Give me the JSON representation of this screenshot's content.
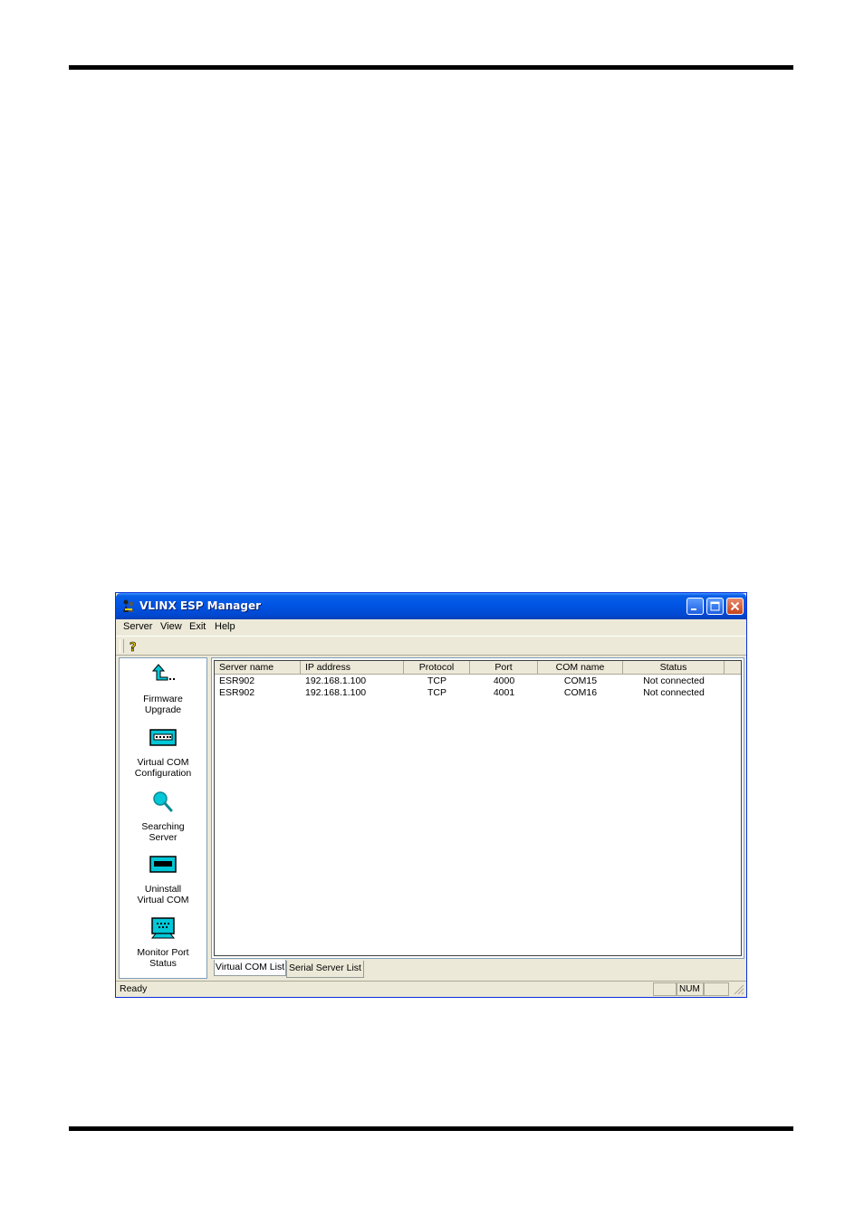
{
  "window": {
    "title": "VLINX ESP Manager"
  },
  "menu": {
    "items": [
      "Server",
      "View",
      "Exit",
      "Help"
    ]
  },
  "toolbar": {
    "buttons": [
      {
        "icon": "help-question-icon",
        "label": "?"
      }
    ]
  },
  "sidebar": {
    "items": [
      {
        "label": "Firmware\nUpgrade",
        "icon": "firmware-upgrade-icon"
      },
      {
        "label": "Virtual COM\nConfiguration",
        "icon": "serial-connector-icon"
      },
      {
        "label": "Searching\nServer",
        "icon": "magnifier-icon"
      },
      {
        "label": "Uninstall\nVirtual COM",
        "icon": "uninstall-connector-icon"
      },
      {
        "label": "Monitor Port\nStatus",
        "icon": "monitor-icon"
      }
    ]
  },
  "table": {
    "columns": [
      "Server name",
      "IP address",
      "Protocol",
      "Port",
      "COM name",
      "Status"
    ],
    "rows": [
      [
        "ESR902",
        "192.168.1.100",
        "TCP",
        "4000",
        "COM15",
        "Not connected"
      ],
      [
        "ESR902",
        "192.168.1.100",
        "TCP",
        "4001",
        "COM16",
        "Not connected"
      ]
    ]
  },
  "tabs": [
    {
      "label": "Virtual COM List",
      "active": false
    },
    {
      "label": "Serial Server List",
      "active": true
    }
  ],
  "statusbar": {
    "text": "Ready",
    "num": "NUM"
  },
  "colors": {
    "titlebar": "#0055e5",
    "close_button": "#c6441c",
    "window_face": "#ece9d8",
    "icon_cyan": "#00c8d8"
  }
}
